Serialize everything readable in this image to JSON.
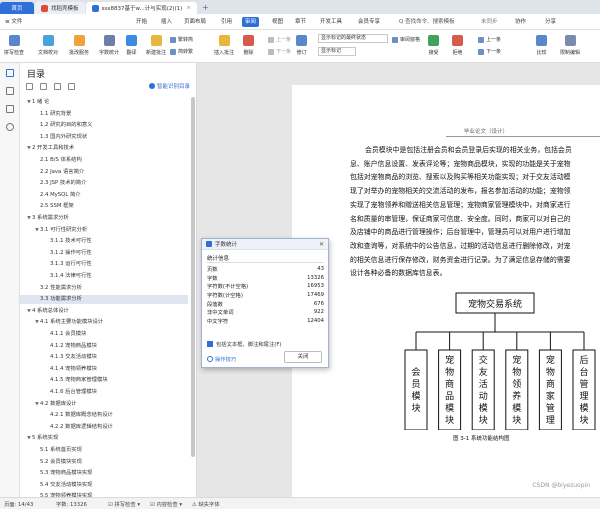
{
  "tabs": [
    {
      "label": "首页",
      "color": "#2f6fd8"
    },
    {
      "label": "找稻壳模板",
      "color": "#e04a3a"
    },
    {
      "label": "ssx8837基于w...计与实现(2)(1)",
      "color": "#2f6fd8"
    }
  ],
  "menu": {
    "file": "文件",
    "items": [
      "开始",
      "插入",
      "页面布局",
      "引用",
      "审阅",
      "视图",
      "章节",
      "开发工具",
      "会员专享"
    ],
    "selected_index": 4,
    "search": "Q 查找命令、搜索模板",
    "right": [
      "未同步",
      "协作",
      "分享"
    ]
  },
  "ribbon": {
    "buttons": [
      "拼写检查",
      "文档校对",
      "批改服务",
      "字数统计",
      "翻译",
      "新建批注",
      "删除",
      "上一条",
      "下一条",
      "修订",
      "接受",
      "拒绝",
      "上一条",
      "下一条",
      "比较",
      "限制编辑",
      "文档权限"
    ],
    "small": [
      "繁转简",
      "简转繁",
      "插入批注",
      "显示批注",
      "审阅窗格"
    ],
    "display_select": "显示标记的最终状态",
    "show_markup": "显示标记"
  },
  "toc": {
    "title": "目录",
    "smart": "智能识别目录",
    "items": [
      {
        "text": "1 绪  论",
        "level": 1,
        "expand": "▼"
      },
      {
        "text": "1.1 研究背景",
        "level": 2
      },
      {
        "text": "1.2 研究的目的和意义",
        "level": 2
      },
      {
        "text": "1.3 国内外研究现状",
        "level": 2
      },
      {
        "text": "2 开发工具和技术",
        "level": 1,
        "expand": "▼"
      },
      {
        "text": "2.1 B/S 体系结构",
        "level": 2
      },
      {
        "text": "2.2 Java 语言简介",
        "level": 2
      },
      {
        "text": "2.3 JSP 技术的简介",
        "level": 2
      },
      {
        "text": "2.4 MySQL 简介",
        "level": 2
      },
      {
        "text": "2.5 SSM 框架",
        "level": 2
      },
      {
        "text": "3 系统需求分析",
        "level": 1,
        "expand": "▼"
      },
      {
        "text": "3.1 可行性研究分析",
        "level": 2,
        "expand": "▼"
      },
      {
        "text": "3.1.1 技术可行性",
        "level": 3
      },
      {
        "text": "3.1.2 操作可行性",
        "level": 3
      },
      {
        "text": "3.1.3 运行可行性",
        "level": 3
      },
      {
        "text": "3.1.4 法律可行性",
        "level": 3
      },
      {
        "text": "3.2 性能需求分析",
        "level": 2
      },
      {
        "text": "3.3 功能需求分析",
        "level": 2,
        "selected": true
      },
      {
        "text": "4 系统总体设计",
        "level": 1,
        "expand": "▼"
      },
      {
        "text": "4.1 系统主要功能模块设计",
        "level": 2,
        "expand": "▼"
      },
      {
        "text": "4.1.1 会员模块",
        "level": 3
      },
      {
        "text": "4.1.2 宠物商品模块",
        "level": 3
      },
      {
        "text": "4.1.3 交友活动模块",
        "level": 3
      },
      {
        "text": "4.1.4 宠物领养模块",
        "level": 3
      },
      {
        "text": "4.1.5 宠物商家管理模块",
        "level": 3
      },
      {
        "text": "4.1.6 后台管理模块",
        "level": 3
      },
      {
        "text": "4.2 数据库设计",
        "level": 2,
        "expand": "▼"
      },
      {
        "text": "4.2.1 数据库概念结构设计",
        "level": 3
      },
      {
        "text": "4.2.2 数据库逻辑结构设计",
        "level": 3
      },
      {
        "text": "5 系统实现",
        "level": 1,
        "expand": "▼"
      },
      {
        "text": "5.1 系统首页实现",
        "level": 2
      },
      {
        "text": "5.2 会员模块实现",
        "level": 2
      },
      {
        "text": "5.3 宠物商品模块实现",
        "level": 2
      },
      {
        "text": "5.4 交友活动模块实现",
        "level": 2
      },
      {
        "text": "5.5 宠物领养模块实现",
        "level": 2
      },
      {
        "text": "5.6 宠物商家管理模块实现",
        "level": 2
      },
      {
        "text": "5.7 后台管理模块实现",
        "level": 2
      }
    ]
  },
  "document": {
    "header": "毕业论文（设计）",
    "paragraphs": [
      "会员模块中是包括注册会员和会员登录后实现的相关业务，包括会员",
      "息、账户信息设置、发表评论等；宠物商品模块，实现的功能是关于宠物",
      "包括对宠物商品的浏览、搜索以及购买等相关功能实现；对于交友活动模",
      "现了对举办的宠物相关的交流活动的发布，报名参加活动的功能；宠物领",
      "实现了宠物领养和赠送相关信息管理；宠物商家管理模块中，对商家进行",
      "名和质量的审管理，保证商家可信度、安全度。同时，商家可以对自己的",
      "及店铺中的商品进行管理操作；后台管理中，管理员可以对用户进行增加",
      "改和查询等，对系统中的公告信息，过期的活动信息进行删除修改，对宠",
      "的相关信息进行保存修改，财务资金进行记录。为了满足信息存储的需要",
      "设计各种必备的数据库信息表。"
    ],
    "diagram": {
      "root": "宠物交易系统",
      "modules": [
        "会员模块",
        "宠物商品模块",
        "交友活动模块",
        "宠物领养模块",
        "宠物商家管理",
        "后台管理模块"
      ]
    },
    "caption": "图 3-1 系统功能结构图"
  },
  "word_count_dialog": {
    "title": "字数统计",
    "heading": "统计信息",
    "stats": [
      {
        "label": "页数",
        "value": "43"
      },
      {
        "label": "字数",
        "value": "13326"
      },
      {
        "label": "字符数(不计空格)",
        "value": "16953"
      },
      {
        "label": "字符数(计空格)",
        "value": "17469"
      },
      {
        "label": "段落数",
        "value": "676"
      },
      {
        "label": "非中文单词",
        "value": "922"
      },
      {
        "label": "中文字符",
        "value": "12404"
      }
    ],
    "checkbox": "包括文本框、脚注和尾注(F)",
    "help": "操作技巧",
    "close": "关闭"
  },
  "status": {
    "page": "页面: 14/43",
    "words": "字数: 13326",
    "spell": "拼写检查",
    "content": "内容检查",
    "missing_font": "缺失字体"
  },
  "watermark": "CSDN @biyezuopin"
}
